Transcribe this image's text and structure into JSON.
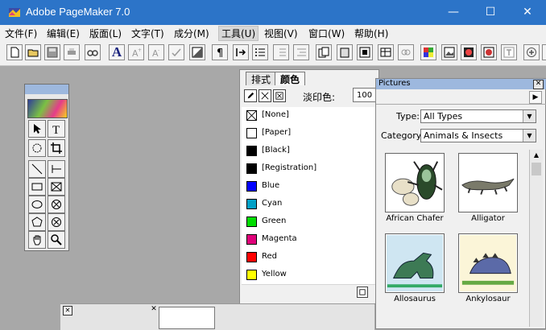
{
  "window": {
    "title": "Adobe PageMaker 7.0",
    "minimize": "—",
    "maximize": "☐",
    "close": "✕"
  },
  "menu": [
    {
      "label": "文件(F)"
    },
    {
      "label": "编辑(E)"
    },
    {
      "label": "版面(L)"
    },
    {
      "label": "文字(T)"
    },
    {
      "label": "成分(M)"
    },
    {
      "label": "工具(U)"
    },
    {
      "label": "视图(V)"
    },
    {
      "label": "窗口(W)"
    },
    {
      "label": "帮助(H)"
    }
  ],
  "colors_panel": {
    "tab_style": "排式",
    "tab_colors": "颜色",
    "tint_label": "淡印色:",
    "tint_value": "100",
    "swatches": [
      {
        "label": "[None]",
        "color": "#ffffff"
      },
      {
        "label": "[Paper]",
        "color": "#ffffff"
      },
      {
        "label": "[Black]",
        "color": "#000000"
      },
      {
        "label": "[Registration]",
        "color": "#000000"
      },
      {
        "label": "Blue",
        "color": "#0000ff"
      },
      {
        "label": "Cyan",
        "color": "#00a0c6"
      },
      {
        "label": "Green",
        "color": "#00dd00"
      },
      {
        "label": "Magenta",
        "color": "#e0007a"
      },
      {
        "label": "Red",
        "color": "#ff0000"
      },
      {
        "label": "Yellow",
        "color": "#ffff00"
      }
    ]
  },
  "pictures_panel": {
    "title": "Pictures",
    "type_label": "Type:",
    "type_value": "All Types",
    "category_label": "Category:",
    "category_value": "Animals & Insects",
    "items": [
      {
        "label": "African Chafer",
        "icon": "beetle-icon"
      },
      {
        "label": "Alligator",
        "icon": "alligator-icon"
      },
      {
        "label": "Allosaurus",
        "icon": "allosaurus-icon"
      },
      {
        "label": "Ankylosaur",
        "icon": "ankylosaur-icon"
      }
    ]
  },
  "toolbar": {
    "font_text_icon": "A"
  }
}
